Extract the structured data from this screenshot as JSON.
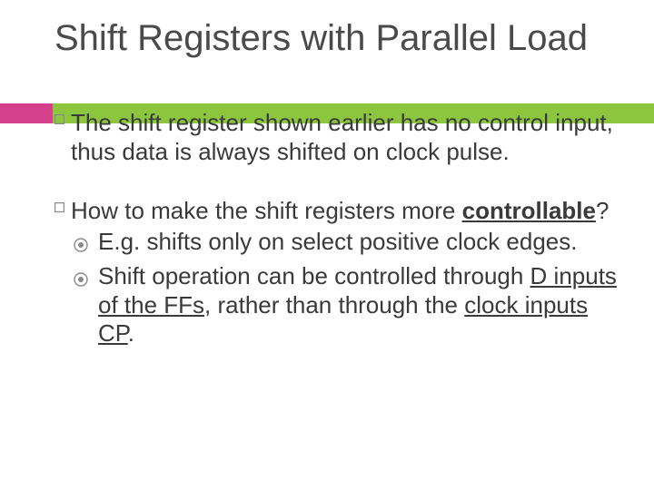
{
  "title": "Shift Registers with Parallel Load",
  "bullets": [
    {
      "text": "The shift register shown earlier has no control input, thus data is always shifted on clock pulse."
    },
    {
      "lead": "How to make the shift registers more ",
      "emph": "controllable",
      "tail": "?",
      "subs": [
        {
          "text": "E.g. shifts only on select positive clock edges."
        },
        {
          "pre": "Shift operation can be controlled through ",
          "u1": "D inputs of the FFs",
          "mid": ", rather than through the ",
          "u2": "clock inputs CP",
          "post": "."
        }
      ]
    }
  ]
}
